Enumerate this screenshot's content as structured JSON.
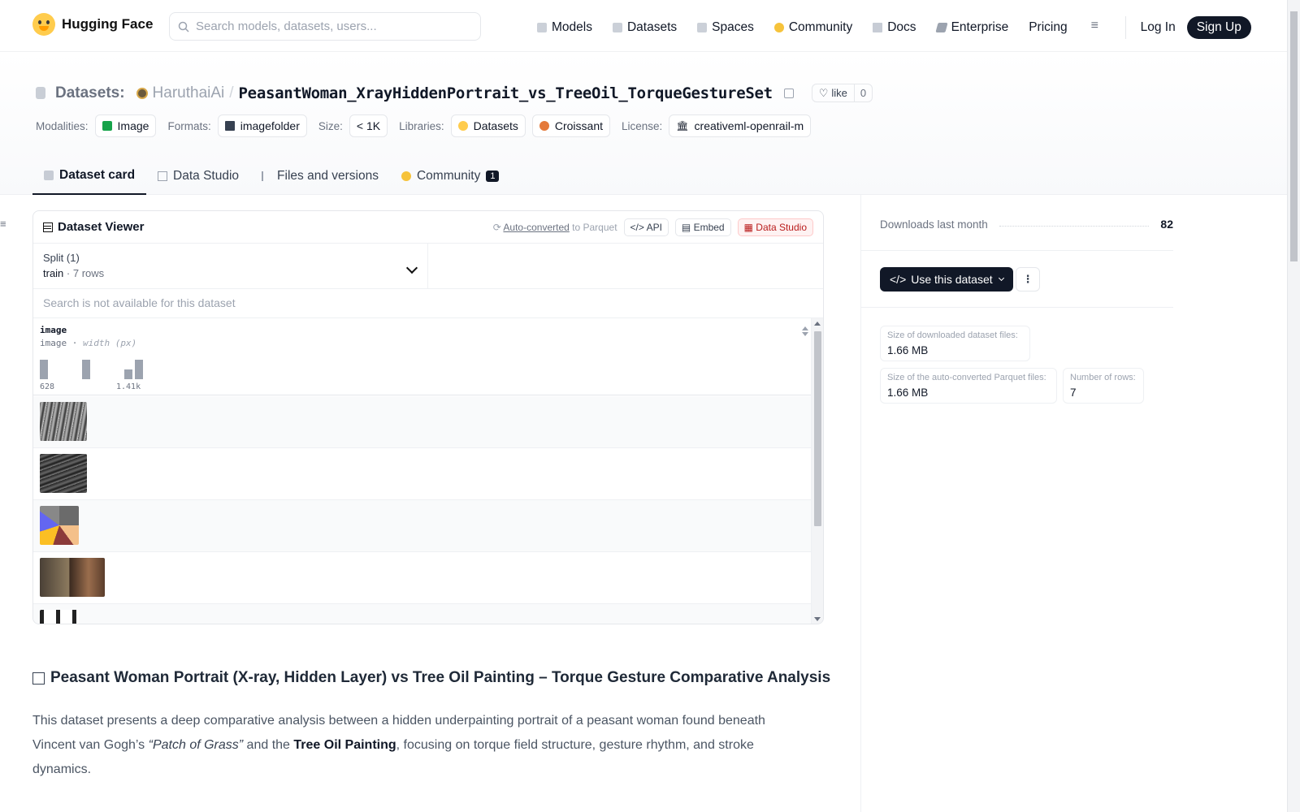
{
  "nav": {
    "brand": "Hugging Face",
    "search_placeholder": "Search models, datasets, users...",
    "items": [
      {
        "label": "Models",
        "icon": "models-icon"
      },
      {
        "label": "Datasets",
        "icon": "datasets-icon"
      },
      {
        "label": "Spaces",
        "icon": "spaces-icon"
      },
      {
        "label": "Community",
        "icon": "community-icon"
      },
      {
        "label": "Docs",
        "icon": "docs-icon"
      },
      {
        "label": "Enterprise",
        "icon": "enterprise-icon"
      },
      {
        "label": "Pricing",
        "icon": ""
      }
    ],
    "login": "Log In",
    "signup": "Sign Up"
  },
  "header": {
    "section_label": "Datasets:",
    "owner": "HaruthaiAi",
    "separator": "/",
    "repo": "PeasantWoman_XrayHiddenPortrait_vs_TreeOil_TorqueGestureSet",
    "like_label": "like",
    "like_count": "0",
    "meta": {
      "modalities_key": "Modalities:",
      "modalities_val": "Image",
      "formats_key": "Formats:",
      "formats_val": "imagefolder",
      "size_key": "Size:",
      "size_val": "< 1K",
      "libraries_key": "Libraries:",
      "lib1": "Datasets",
      "lib2": "Croissant",
      "license_key": "License:",
      "license_val": "creativeml-openrail-m"
    },
    "tabs": [
      {
        "label": "Dataset card"
      },
      {
        "label": "Data Studio"
      },
      {
        "label": "Files and versions"
      },
      {
        "label": "Community",
        "badge": "1"
      }
    ]
  },
  "viewer": {
    "title": "Dataset Viewer",
    "autoconv_link": "Auto-converted",
    "autoconv_rest": "to Parquet",
    "api": "API",
    "embed": "Embed",
    "studio": "Data Studio",
    "split_label": "Split (1)",
    "split_name": "train",
    "split_rows": "7 rows",
    "search_disabled": "Search is not available for this dataset",
    "column": {
      "name": "image",
      "type": "image",
      "stat": "width (px)",
      "tick_min": "628",
      "tick_max": "1.41k"
    }
  },
  "article": {
    "heading": "Peasant Woman Portrait (X-ray, Hidden Layer) vs Tree Oil Painting – Torque Gesture Comparative Analysis",
    "p1": "This dataset presents a deep comparative analysis between a hidden underpainting portrait of a peasant woman found beneath Vincent van Gogh’s ",
    "p1_em": "“Patch of Grass”",
    "p1_mid": " and the ",
    "p1_bold": "Tree Oil Painting",
    "p1_end": ", focusing on torque field structure, gesture rhythm, and stroke dynamics."
  },
  "sidebar": {
    "downloads_label": "Downloads last month",
    "downloads_value": "82",
    "use_button": "Use this dataset",
    "stats": [
      {
        "label": "Size of downloaded dataset files:",
        "value": "1.66 MB"
      },
      {
        "label": "Size of the auto-converted Parquet files:",
        "value": "1.66 MB"
      },
      {
        "label": "Number of rows:",
        "value": "7"
      }
    ]
  }
}
